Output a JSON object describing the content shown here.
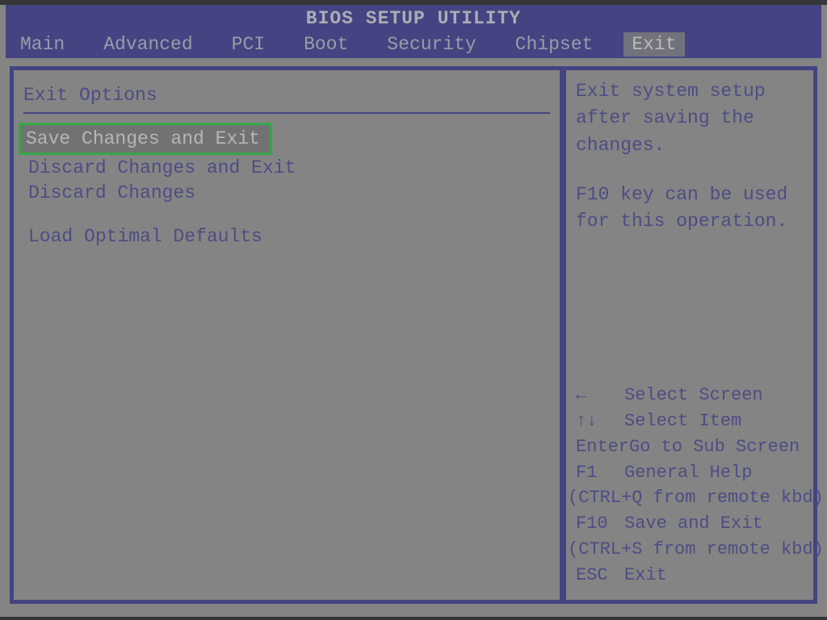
{
  "header": {
    "title": "BIOS SETUP UTILITY",
    "tabs": [
      {
        "label": "Main",
        "active": false
      },
      {
        "label": "Advanced",
        "active": false
      },
      {
        "label": "PCI",
        "active": false
      },
      {
        "label": "Boot",
        "active": false
      },
      {
        "label": "Security",
        "active": false
      },
      {
        "label": "Chipset",
        "active": false
      },
      {
        "label": "Exit",
        "active": true
      }
    ]
  },
  "left_panel": {
    "section_title": "Exit Options",
    "options": [
      {
        "label": "Save Changes and Exit",
        "selected": true
      },
      {
        "label": "Discard Changes and Exit",
        "selected": false
      },
      {
        "label": "Discard Changes",
        "selected": false
      },
      {
        "label": "",
        "spacer": true
      },
      {
        "label": "Load Optimal Defaults",
        "selected": false
      }
    ]
  },
  "right_panel": {
    "help_lines": [
      "Exit system setup",
      "after saving the",
      "changes.",
      "",
      "F10 key can be used",
      "for this operation."
    ],
    "keys": [
      {
        "key": "←",
        "action": "Select Screen"
      },
      {
        "key": "↑↓",
        "action": "Select Item"
      },
      {
        "key": "Enter",
        "action": "Go to Sub Screen"
      },
      {
        "key": "F1",
        "action": "General Help"
      },
      {
        "paren": "(CTRL+Q from remote kbd)"
      },
      {
        "key": "F10",
        "action": "Save and Exit"
      },
      {
        "paren": "(CTRL+S from remote kbd)"
      },
      {
        "key": "ESC",
        "action": "Exit"
      }
    ]
  }
}
